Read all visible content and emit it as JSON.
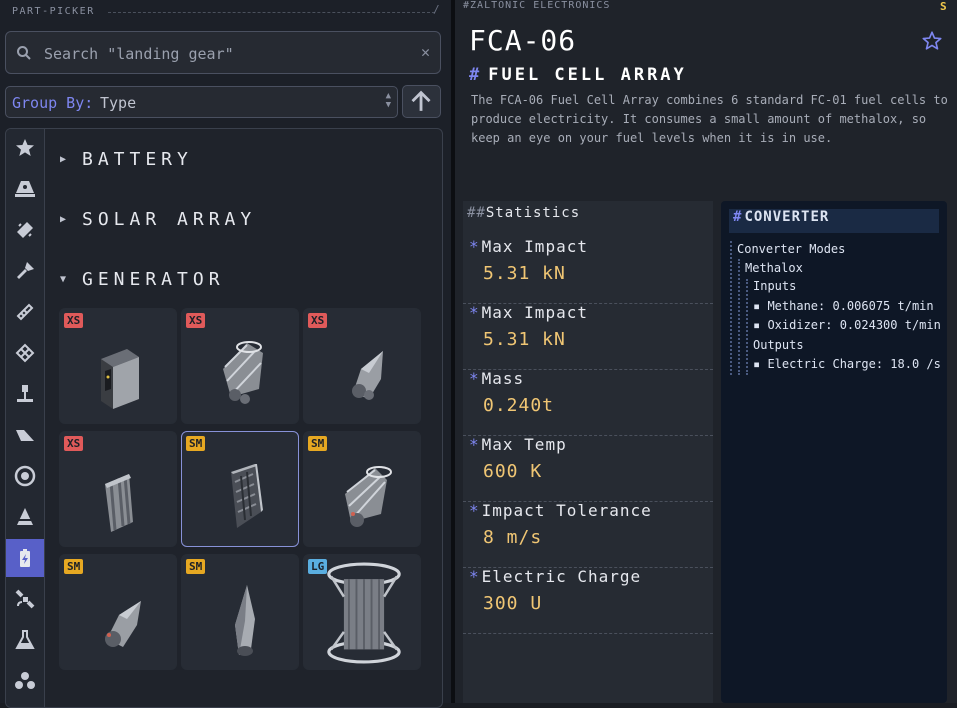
{
  "picker": {
    "title": "PART-PICKER",
    "search_placeholder": "Search \"landing gear\"",
    "group_by_label": "Group By:",
    "group_by_value": "Type",
    "groups": [
      {
        "name": "BATTERY",
        "expanded": false
      },
      {
        "name": "SOLAR ARRAY",
        "expanded": false
      },
      {
        "name": "GENERATOR",
        "expanded": true
      }
    ],
    "parts": [
      {
        "size": "XS",
        "icon": "fuel-cell-pack-icon"
      },
      {
        "size": "XS",
        "icon": "caged-fuel-cell-icon"
      },
      {
        "size": "XS",
        "icon": "cone-generator-icon"
      },
      {
        "size": "XS",
        "icon": "radiator-generator-icon"
      },
      {
        "size": "SM",
        "icon": "fuel-cell-array-icon"
      },
      {
        "size": "SM",
        "icon": "caged-generator-icon"
      },
      {
        "size": "SM",
        "icon": "cone-generator-small-icon"
      },
      {
        "size": "SM",
        "icon": "nose-generator-icon"
      },
      {
        "size": "LG",
        "icon": "large-caged-generator-icon"
      }
    ],
    "tabs": [
      "favorites-star-icon",
      "command-pod-icon",
      "fuel-tank-icon",
      "engine-icon",
      "structural-icon",
      "coupler-icon",
      "landing-gear-icon",
      "wing-icon",
      "wheel-icon",
      "nose-cone-icon",
      "electrical-icon",
      "satellite-icon",
      "science-flask-icon",
      "cargo-icon"
    ],
    "active_tab": 10
  },
  "detail": {
    "manufacturer": "ZALTONIC ELECTRONICS",
    "corner_badge": "S",
    "code": "FCA-06",
    "name": "FUEL CELL ARRAY",
    "description": "The FCA-06 Fuel Cell Array combines 6 standard FC-01 fuel cells to produce electricity. It consumes a small amount of methalox, so keep an eye on your fuel levels when it is in use.",
    "stats_title": "Statistics",
    "stats": [
      {
        "label": "Max Impact",
        "value": "5.31 kN"
      },
      {
        "label": "Max Impact",
        "value": "5.31 kN"
      },
      {
        "label": "Mass",
        "value": "0.240t"
      },
      {
        "label": "Max Temp",
        "value": "600 K"
      },
      {
        "label": "Impact Tolerance",
        "value": "8 m/s"
      },
      {
        "label": "Electric Charge",
        "value": "300 U"
      }
    ],
    "converter": {
      "title": "CONVERTER",
      "modes_label": "Converter Modes",
      "mode": "Methalox",
      "inputs_label": "Inputs",
      "inputs": [
        "Methane: 0.006075 t/min",
        "Oxidizer: 0.024300 t/min"
      ],
      "outputs_label": "Outputs",
      "outputs": [
        "Electric Charge: 18.0 /s"
      ]
    }
  },
  "colors": {
    "accent": "#5860c8",
    "xs": "#e05a5a",
    "sm": "#e6a822",
    "lg": "#5aaee0",
    "value": "#f0c674"
  }
}
